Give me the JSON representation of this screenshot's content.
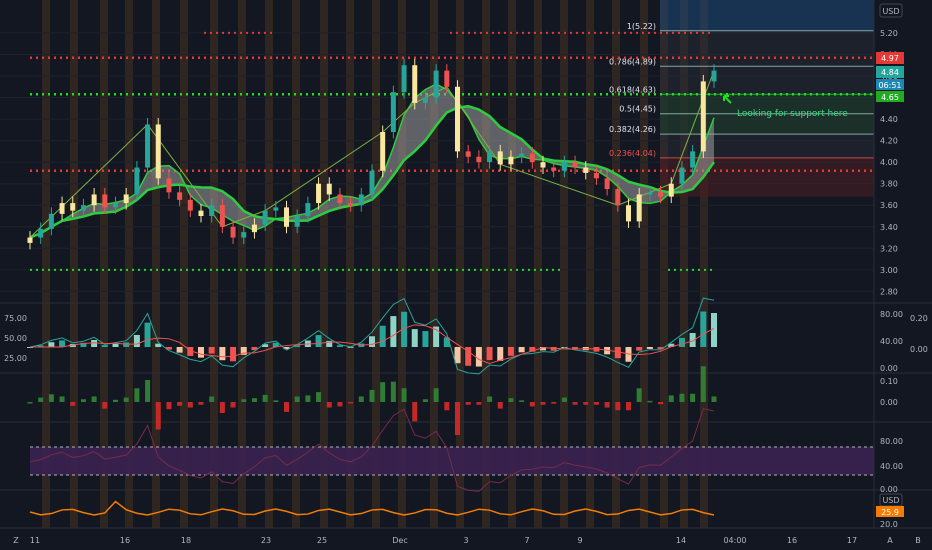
{
  "currency_label": "USD",
  "currency_label_bottom": "USD",
  "bottom_right": {
    "auto_label": "A",
    "log_label": "B"
  },
  "bottom_left_zoom_icon": "Z",
  "annotation": {
    "text": "Looking for support here",
    "arrow_icon": "arrow-up-left-icon"
  },
  "price_tags": {
    "red_tag": "4.97",
    "last_price": "4.84",
    "blue_tag": "06:51",
    "green_tag": "4.65",
    "rsi_tag": "25.9"
  },
  "colors": {
    "bg": "#131722",
    "up": "#26a69a",
    "down": "#ef5350",
    "ema_green": "#2ecc40",
    "red_dotted": "#e53935",
    "green_dotted": "#22dd22",
    "orange_rsi": "#f57c00",
    "purple_band": "#3a2250",
    "orange_session": "#7a4a20"
  },
  "chart_data": [
    {
      "type": "line",
      "title": "",
      "panel": "price",
      "ylim": [
        2.72,
        5.32
      ],
      "y_ticks": [
        "5.20",
        "5.00",
        "4.80",
        "4.60",
        "4.40",
        "4.20",
        "4.00",
        "3.80",
        "3.60",
        "3.40",
        "3.20",
        "3.00",
        "2.80"
      ],
      "x_ticks": [
        "11",
        "16",
        "18",
        "23",
        "25",
        "Dec",
        "3",
        "7",
        "9",
        "14",
        "04:00",
        "16",
        "17"
      ],
      "series": [
        {
          "y": [
            3.3,
            3.38,
            3.52,
            3.62,
            3.55,
            3.6,
            3.7,
            3.58,
            3.62,
            3.7,
            3.95,
            4.35,
            3.85,
            3.72,
            3.65,
            3.55,
            3.5,
            3.6,
            3.4,
            3.3,
            3.35,
            3.42,
            3.55,
            3.58,
            3.4,
            3.5,
            3.62,
            3.8,
            3.7,
            3.62,
            3.6,
            3.7,
            3.92,
            4.28,
            4.65,
            4.9,
            4.55,
            4.6,
            4.85,
            4.7,
            4.1,
            4.05,
            4.0,
            4.1,
            3.98,
            4.05,
            4.08,
            4.0,
            3.95,
            3.92,
            4.0,
            3.95,
            3.9,
            3.85,
            3.75,
            3.6,
            3.45,
            3.7,
            3.72,
            3.68,
            3.8,
            3.95,
            4.1,
            4.75,
            4.85
          ]
        }
      ],
      "fibonacci": [
        {
          "label": "1(5.22)",
          "value": 5.22
        },
        {
          "label": "0.786(4.89)",
          "value": 4.89
        },
        {
          "label": "0.618(4.63)",
          "value": 4.63
        },
        {
          "label": "0.5(4.45)",
          "value": 4.45
        },
        {
          "label": "0.382(4.26)",
          "value": 4.26
        },
        {
          "label": "0.236(4.04)",
          "value": 4.04
        }
      ],
      "horizontal_levels": [
        {
          "name": "resistance-top",
          "value": 5.2
        },
        {
          "name": "resistance",
          "value": 4.97
        },
        {
          "name": "support",
          "value": 4.63
        },
        {
          "name": "mid-level",
          "value": 3.92
        },
        {
          "name": "floor",
          "value": 3.0
        }
      ]
    },
    {
      "type": "line",
      "panel": "oscillator",
      "y_ticks_left": [
        "75.00",
        "50.00",
        "25.00"
      ],
      "y_ticks_right": [
        "80.00",
        "40.00",
        "0.00"
      ],
      "y_ticks_right2": [
        "0.20",
        "0.00"
      ]
    },
    {
      "type": "bar",
      "panel": "momentum",
      "y_ticks": [
        "0.10",
        "0.00"
      ]
    },
    {
      "type": "line",
      "panel": "rsi",
      "y_ticks": [
        "80.00",
        "40.00",
        "0.00"
      ]
    },
    {
      "type": "line",
      "panel": "volume-oscillator",
      "y_ticks": [
        "20.0"
      ]
    }
  ]
}
